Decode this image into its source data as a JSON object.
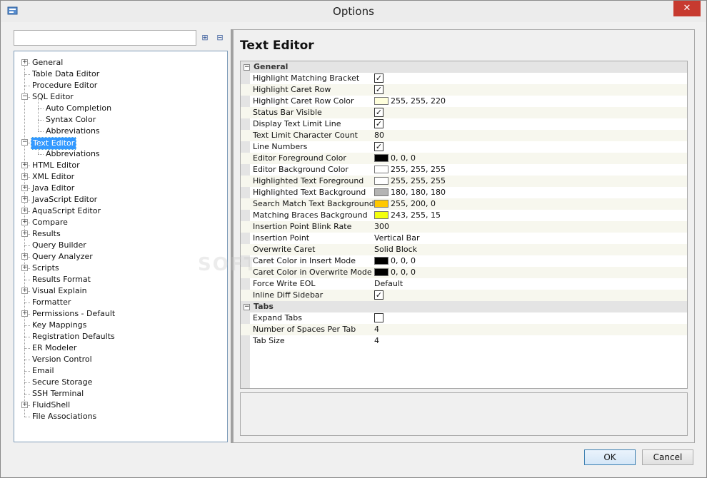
{
  "window": {
    "title": "Options",
    "close_glyph": "✕"
  },
  "toolbar": {
    "search_value": "",
    "expand_icon": "⊞",
    "collapse_icon": "⊟"
  },
  "tree": [
    {
      "label": "General",
      "level": 0,
      "expander": "+"
    },
    {
      "label": "Table Data Editor",
      "level": 0,
      "expander": ""
    },
    {
      "label": "Procedure Editor",
      "level": 0,
      "expander": ""
    },
    {
      "label": "SQL Editor",
      "level": 0,
      "expander": "−"
    },
    {
      "label": "Auto Completion",
      "level": 1,
      "expander": ""
    },
    {
      "label": "Syntax Color",
      "level": 1,
      "expander": ""
    },
    {
      "label": "Abbreviations",
      "level": 1,
      "expander": ""
    },
    {
      "label": "Text Editor",
      "level": 0,
      "expander": "−",
      "selected": true
    },
    {
      "label": "Abbreviations",
      "level": 1,
      "expander": ""
    },
    {
      "label": "HTML Editor",
      "level": 0,
      "expander": "+"
    },
    {
      "label": "XML Editor",
      "level": 0,
      "expander": "+"
    },
    {
      "label": "Java Editor",
      "level": 0,
      "expander": "+"
    },
    {
      "label": "JavaScript Editor",
      "level": 0,
      "expander": "+"
    },
    {
      "label": "AquaScript Editor",
      "level": 0,
      "expander": "+"
    },
    {
      "label": "Compare",
      "level": 0,
      "expander": "+"
    },
    {
      "label": "Results",
      "level": 0,
      "expander": "+"
    },
    {
      "label": "Query Builder",
      "level": 0,
      "expander": ""
    },
    {
      "label": "Query Analyzer",
      "level": 0,
      "expander": "+"
    },
    {
      "label": "Scripts",
      "level": 0,
      "expander": "+"
    },
    {
      "label": "Results Format",
      "level": 0,
      "expander": ""
    },
    {
      "label": "Visual Explain",
      "level": 0,
      "expander": "+"
    },
    {
      "label": "Formatter",
      "level": 0,
      "expander": ""
    },
    {
      "label": "Permissions - Default",
      "level": 0,
      "expander": "+"
    },
    {
      "label": "Key Mappings",
      "level": 0,
      "expander": ""
    },
    {
      "label": "Registration Defaults",
      "level": 0,
      "expander": ""
    },
    {
      "label": "ER Modeler",
      "level": 0,
      "expander": ""
    },
    {
      "label": "Version Control",
      "level": 0,
      "expander": ""
    },
    {
      "label": "Email",
      "level": 0,
      "expander": ""
    },
    {
      "label": "Secure Storage",
      "level": 0,
      "expander": ""
    },
    {
      "label": "SSH Terminal",
      "level": 0,
      "expander": ""
    },
    {
      "label": "FluidShell",
      "level": 0,
      "expander": "+"
    },
    {
      "label": "File Associations",
      "level": 0,
      "expander": ""
    }
  ],
  "panel": {
    "title": "Text Editor",
    "categories": [
      {
        "name": "General",
        "toggle": "−",
        "props": [
          {
            "name": "Highlight Matching Bracket",
            "type": "check",
            "checked": true
          },
          {
            "name": "Highlight Caret Row",
            "type": "check",
            "checked": true
          },
          {
            "name": "Highlight Caret Row Color",
            "type": "color",
            "color": "#ffffdc",
            "value": "255, 255, 220"
          },
          {
            "name": "Status Bar Visible",
            "type": "check",
            "checked": true
          },
          {
            "name": "Display Text Limit Line",
            "type": "check",
            "checked": true
          },
          {
            "name": "Text Limit Character Count",
            "type": "text",
            "value": "80"
          },
          {
            "name": "Line Numbers",
            "type": "check",
            "checked": true
          },
          {
            "name": "Editor Foreground Color",
            "type": "color",
            "color": "#000000",
            "value": "0, 0, 0"
          },
          {
            "name": "Editor Background Color",
            "type": "color",
            "color": "#ffffff",
            "value": "255, 255, 255"
          },
          {
            "name": "Highlighted Text Foreground",
            "type": "color",
            "color": "#ffffff",
            "value": "255, 255, 255"
          },
          {
            "name": "Highlighted Text Background",
            "type": "color",
            "color": "#b4b4b4",
            "value": "180, 180, 180"
          },
          {
            "name": "Search Match Text Background",
            "type": "color",
            "color": "#ffc800",
            "value": "255, 200, 0"
          },
          {
            "name": "Matching Braces Background",
            "type": "color",
            "color": "#f3ff0f",
            "value": "243, 255, 15"
          },
          {
            "name": "Insertion Point Blink Rate",
            "type": "text",
            "value": "300"
          },
          {
            "name": "Insertion Point",
            "type": "text",
            "value": "Vertical Bar"
          },
          {
            "name": "Overwrite Caret",
            "type": "text",
            "value": "Solid Block"
          },
          {
            "name": "Caret Color in Insert Mode",
            "type": "color",
            "color": "#000000",
            "value": "0, 0, 0"
          },
          {
            "name": "Caret Color in Overwrite Mode",
            "type": "color",
            "color": "#000000",
            "value": "0, 0, 0"
          },
          {
            "name": "Force Write EOL",
            "type": "text",
            "value": "Default"
          },
          {
            "name": "Inline Diff Sidebar",
            "type": "check",
            "checked": true
          }
        ]
      },
      {
        "name": "Tabs",
        "toggle": "−",
        "props": [
          {
            "name": "Expand Tabs",
            "type": "check",
            "checked": false
          },
          {
            "name": "Number of Spaces Per Tab",
            "type": "text",
            "value": "4"
          },
          {
            "name": "Tab Size",
            "type": "text",
            "value": "4"
          }
        ]
      }
    ]
  },
  "buttons": {
    "ok": "OK",
    "cancel": "Cancel"
  },
  "watermark": "SOFT"
}
